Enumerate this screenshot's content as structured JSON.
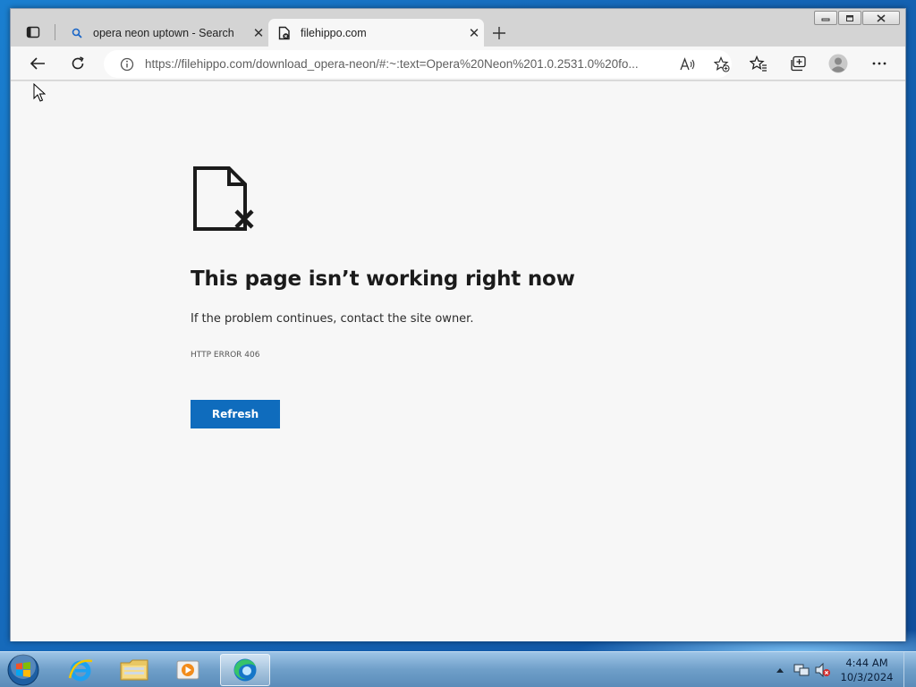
{
  "browser": {
    "tabs": [
      {
        "title": "opera neon uptown - Search",
        "favicon": "search-icon",
        "active": false
      },
      {
        "title": "filehippo.com",
        "favicon": "page-error-icon",
        "active": true
      }
    ],
    "address": {
      "url": "https://filehippo.com/download_opera-neon/#:~:text=Opera%20Neon%201.0.2531.0%20fo..."
    },
    "window_controls": [
      "minimize",
      "restore",
      "close"
    ]
  },
  "page": {
    "title": "This page isn’t working right now",
    "message": "If the problem continues, contact the site owner.",
    "error_code": "HTTP ERROR 406",
    "refresh_label": "Refresh"
  },
  "taskbar": {
    "apps": [
      "internet-explorer-icon",
      "file-explorer-icon",
      "media-player-icon",
      "edge-icon"
    ],
    "active_app": "edge-icon",
    "clock": {
      "time": "4:44 AM",
      "date": "10/3/2024"
    }
  },
  "colors": {
    "accent": "#0f6cbd",
    "page_bg": "#f7f7f7",
    "taskbar": "#6f9fc9"
  }
}
